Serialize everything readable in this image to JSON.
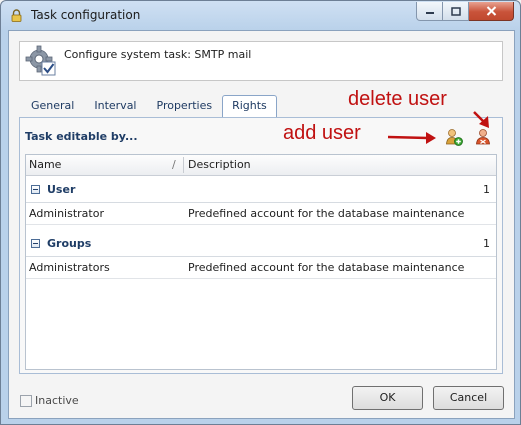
{
  "window": {
    "title": "Task configuration"
  },
  "header": {
    "text": "Configure system task: SMTP mail"
  },
  "tabs": [
    {
      "label": "General"
    },
    {
      "label": "Interval"
    },
    {
      "label": "Properties"
    },
    {
      "label": "Rights",
      "active": true
    }
  ],
  "rights": {
    "section_title": "Task editable by...",
    "columns": {
      "name": "Name",
      "description": "Description"
    },
    "groups": [
      {
        "label": "User",
        "count": "1",
        "rows": [
          {
            "name": "Administrator",
            "description": "Predefined account for the database maintenance"
          }
        ]
      },
      {
        "label": "Groups",
        "count": "1",
        "rows": [
          {
            "name": "Administrators",
            "description": "Predefined account for the database maintenance"
          }
        ]
      }
    ]
  },
  "annotations": {
    "delete_user": "delete user",
    "add_user": "add user"
  },
  "footer": {
    "inactive_label": "Inactive",
    "inactive_checked": false,
    "ok_label": "OK",
    "cancel_label": "Cancel"
  },
  "colors": {
    "annotation": "#c01111",
    "accent": "#1f3d66"
  },
  "icons": {
    "title": "lock-icon",
    "header": "gear-check-icon",
    "add": "add-user-icon",
    "delete": "delete-user-icon"
  }
}
